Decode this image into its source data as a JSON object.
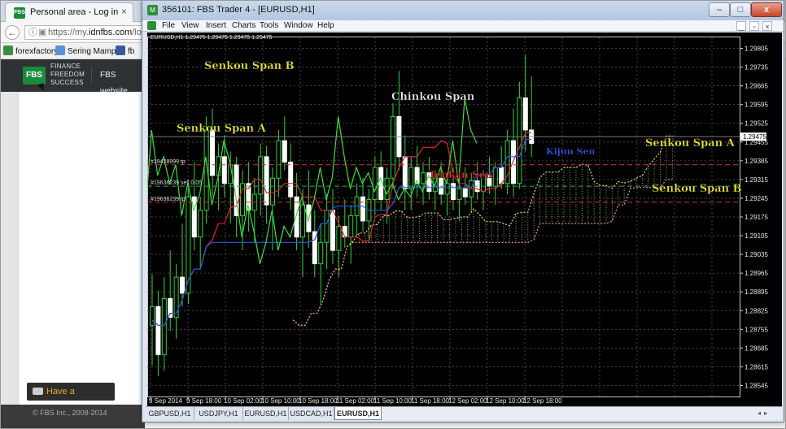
{
  "browser": {
    "tab_title": "Personal area - Log in",
    "tab_close": "×",
    "back_glyph": "←",
    "url_prefix": "https://my.",
    "url_domain": "idnfbs.com",
    "url_rest": "/login",
    "bookmarks": [
      {
        "label": "forexfactory",
        "color": "#3a8e3a"
      },
      {
        "label": "Sering Mampir",
        "color": "#5b8fd6"
      },
      {
        "label": "fb",
        "color": "#3b5998"
      }
    ],
    "fbs_logo": "FBS",
    "fbs_tagline": [
      "FINANCE",
      "FREEDOM",
      "SUCCESS"
    ],
    "fbs_website": "FBS website",
    "have_question": "Have a question?",
    "footer": "© FBS Inc., 2008-2014"
  },
  "mt4": {
    "title": "356101: FBS Trader 4 - [EURUSD,H1]",
    "app_icon": "M",
    "window_buttons": {
      "minimize": "–",
      "maximize": "□",
      "close": "x"
    },
    "menu": [
      "File",
      "View",
      "Insert",
      "Charts",
      "Tools",
      "Window",
      "Help"
    ],
    "mdi_buttons": [
      "_",
      "▫",
      "×"
    ],
    "symbol_tabs": [
      {
        "label": "GBPUSD,H1",
        "active": false
      },
      {
        "label": "USDJPY,H1",
        "active": false
      },
      {
        "label": "EURUSD,H1",
        "active": false
      },
      {
        "label": "USDCAD,H1",
        "active": false
      },
      {
        "label": "EURUSD,H1",
        "active": true
      }
    ],
    "tab_nav": "◂▸"
  },
  "chart_data": {
    "type": "candlestick",
    "symbol_header": "EURUSD,H1  1.29475 1.29475 1.29475 1.29475",
    "current_price": "1.29475",
    "price_levels": [
      "1.29805",
      "1.29735",
      "1.29665",
      "1.29595",
      "1.29525",
      "1.29455",
      "1.29385",
      "1.29315",
      "1.29245",
      "1.29175",
      "1.29105",
      "1.29035",
      "1.28965",
      "1.28895",
      "1.28825",
      "1.28755",
      "1.28685",
      "1.28615",
      "1.28545"
    ],
    "ylim": [
      1.2851,
      1.2984
    ],
    "time_labels": [
      "9 Sep 2014",
      "9 Sep 18:00",
      "10 Sep 02:00",
      "10 Sep 10:00",
      "10 Sep 18:00",
      "11 Sep 02:00",
      "11 Sep 10:00",
      "11 Sep 18:00",
      "12 Sep 02:00",
      "12 Sep 10:00",
      "12 Sep 18:00"
    ],
    "order_lines": [
      {
        "label": "#19428999 tp",
        "price": 1.2937,
        "color": "#c0392b"
      },
      {
        "label": "#19636239 sell 0.05",
        "price": 1.2929,
        "color": "#2fa84f"
      },
      {
        "label": "#19636239 tp",
        "price": 1.2923,
        "color": "#c0392b"
      }
    ],
    "annotations": [
      {
        "text": "Senkou Span B",
        "color": "#e8e23a"
      },
      {
        "text": "Senkou Span A",
        "color": "#e8e23a"
      },
      {
        "text": "Chinkou Span",
        "color": "#e8e8e8"
      },
      {
        "text": "Tenkan Sen",
        "color": "#e0242c"
      },
      {
        "text": "Kijun Sen",
        "color": "#2b56e8"
      },
      {
        "text": "Senkou Span A",
        "color": "#e8e23a"
      },
      {
        "text": "Senkou Span B",
        "color": "#e8e23a"
      }
    ],
    "candles": [
      [
        1.2877,
        1.2896,
        1.2862,
        1.2884
      ],
      [
        1.2884,
        1.289,
        1.2858,
        1.2866
      ],
      [
        1.2866,
        1.2895,
        1.286,
        1.2887
      ],
      [
        1.2887,
        1.2905,
        1.2875,
        1.288
      ],
      [
        1.288,
        1.29,
        1.2872,
        1.2895
      ],
      [
        1.2895,
        1.2915,
        1.2884,
        1.2889
      ],
      [
        1.2889,
        1.293,
        1.2885,
        1.2925
      ],
      [
        1.2925,
        1.2938,
        1.2905,
        1.291
      ],
      [
        1.291,
        1.2925,
        1.2898,
        1.292
      ],
      [
        1.292,
        1.2955,
        1.2915,
        1.295
      ],
      [
        1.295,
        1.2958,
        1.2925,
        1.2933
      ],
      [
        1.2933,
        1.2945,
        1.292,
        1.294
      ],
      [
        1.294,
        1.2948,
        1.2925,
        1.293
      ],
      [
        1.293,
        1.2942,
        1.2915,
        1.2937
      ],
      [
        1.2937,
        1.294,
        1.291,
        1.2918
      ],
      [
        1.2918,
        1.2935,
        1.2905,
        1.293
      ],
      [
        1.293,
        1.2938,
        1.2912,
        1.292
      ],
      [
        1.292,
        1.2932,
        1.2908,
        1.2926
      ],
      [
        1.2926,
        1.2945,
        1.2918,
        1.294
      ],
      [
        1.294,
        1.2944,
        1.2915,
        1.2922
      ],
      [
        1.2922,
        1.2936,
        1.2905,
        1.2932
      ],
      [
        1.2932,
        1.295,
        1.2925,
        1.2946
      ],
      [
        1.2946,
        1.2955,
        1.2935,
        1.2938
      ],
      [
        1.2938,
        1.2945,
        1.292,
        1.2925
      ],
      [
        1.2925,
        1.2934,
        1.2905,
        1.291
      ],
      [
        1.291,
        1.2928,
        1.2895,
        1.2922
      ],
      [
        1.2922,
        1.2935,
        1.2906,
        1.2912
      ],
      [
        1.2912,
        1.292,
        1.2895,
        1.29
      ],
      [
        1.29,
        1.2915,
        1.2885,
        1.2908
      ],
      [
        1.2908,
        1.2926,
        1.2898,
        1.292
      ],
      [
        1.292,
        1.2928,
        1.29,
        1.2905
      ],
      [
        1.2905,
        1.2918,
        1.2895,
        1.2914
      ],
      [
        1.2914,
        1.2924,
        1.2906,
        1.291
      ],
      [
        1.291,
        1.2922,
        1.29,
        1.2918
      ],
      [
        1.2918,
        1.293,
        1.291,
        1.2925
      ],
      [
        1.2925,
        1.2932,
        1.2912,
        1.2916
      ],
      [
        1.2916,
        1.2928,
        1.2908,
        1.2924
      ],
      [
        1.2924,
        1.294,
        1.2918,
        1.2936
      ],
      [
        1.2936,
        1.2942,
        1.292,
        1.2924
      ],
      [
        1.2924,
        1.2936,
        1.2915,
        1.2932
      ],
      [
        1.2932,
        1.296,
        1.2928,
        1.2955
      ],
      [
        1.2955,
        1.2972,
        1.2935,
        1.294
      ],
      [
        1.294,
        1.2948,
        1.292,
        1.2928
      ],
      [
        1.2928,
        1.294,
        1.292,
        1.2936
      ],
      [
        1.2936,
        1.2944,
        1.2925,
        1.293
      ],
      [
        1.293,
        1.2938,
        1.2922,
        1.2934
      ],
      [
        1.2934,
        1.294,
        1.2924,
        1.2927
      ],
      [
        1.2927,
        1.2935,
        1.292,
        1.2932
      ],
      [
        1.2932,
        1.2938,
        1.2922,
        1.2926
      ],
      [
        1.2926,
        1.2934,
        1.2918,
        1.293
      ],
      [
        1.293,
        1.2936,
        1.292,
        1.2924
      ],
      [
        1.2924,
        1.2932,
        1.2916,
        1.2928
      ],
      [
        1.2928,
        1.2936,
        1.2922,
        1.2925
      ],
      [
        1.2925,
        1.2934,
        1.2919,
        1.2931
      ],
      [
        1.2931,
        1.2938,
        1.2924,
        1.2927
      ],
      [
        1.2927,
        1.2935,
        1.292,
        1.2933
      ],
      [
        1.2933,
        1.294,
        1.2926,
        1.2929
      ],
      [
        1.2929,
        1.2938,
        1.2922,
        1.2936
      ],
      [
        1.2936,
        1.2944,
        1.2928,
        1.293
      ],
      [
        1.293,
        1.295,
        1.2926,
        1.2946
      ],
      [
        1.2946,
        1.2958,
        1.2925,
        1.293
      ],
      [
        1.293,
        1.2968,
        1.2928,
        1.2962
      ],
      [
        1.2962,
        1.2978,
        1.2942,
        1.295
      ],
      [
        1.295,
        1.297,
        1.294,
        1.2945
      ]
    ]
  }
}
